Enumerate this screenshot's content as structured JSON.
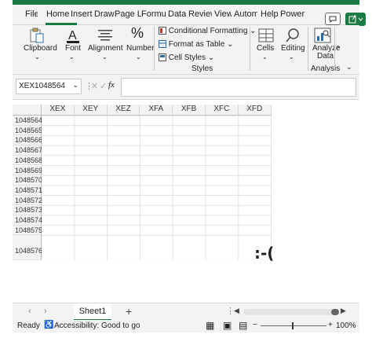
{
  "ribbon_tabs": [
    "File",
    "Home",
    "Insert",
    "Draw",
    "Page La",
    "Formula",
    "Data",
    "Review",
    "View",
    "Automa",
    "Help",
    "Power F"
  ],
  "ribbon": {
    "clipboard": "Clipboard",
    "font": "Font",
    "alignment": "Alignment",
    "number": "Number",
    "conditional_formatting": "Conditional Formatting",
    "format_as_table": "Format as Table",
    "cell_styles": "Cell Styles",
    "styles_group": "Styles",
    "cells": "Cells",
    "editing": "Editing",
    "analyze_data_line1": "Analyze",
    "analyze_data_line2": "Data",
    "analysis_group": "Analysis",
    "number_symbol": "%"
  },
  "formula_bar": {
    "name_box": "XEX1048564",
    "fx": "fx",
    "value": ""
  },
  "columns": [
    "XEX",
    "XEY",
    "XEZ",
    "XFA",
    "XFB",
    "XFC",
    "XFD"
  ],
  "rows": [
    "1048564",
    "1048565",
    "1048566",
    "1048567",
    "1048568",
    "1048569",
    "1048570",
    "1048571",
    "1048572",
    "1048573",
    "1048574",
    "1048575",
    "1048576"
  ],
  "cell_text": ":-(",
  "sheet_tabs": [
    "Sheet1"
  ],
  "status": {
    "ready": "Ready",
    "accessibility": "Accessibility: Good to go",
    "zoom": "100%"
  }
}
